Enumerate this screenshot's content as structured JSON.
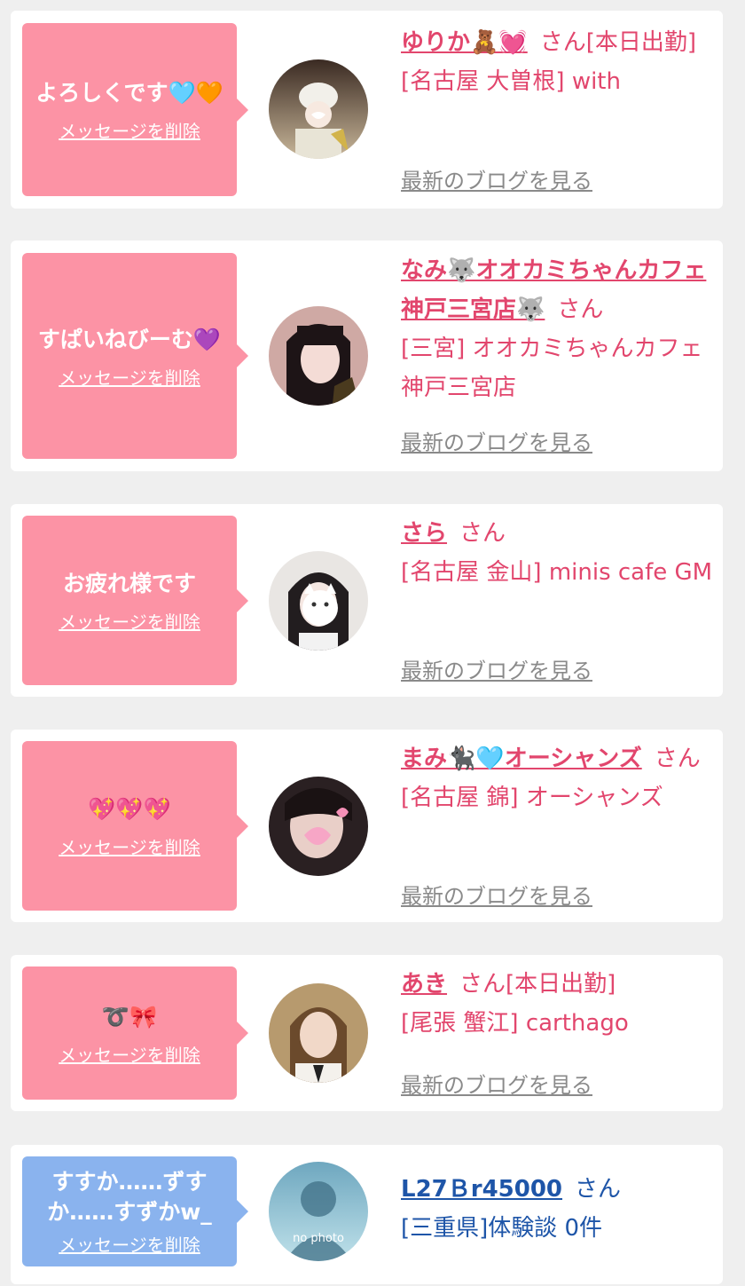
{
  "delete_label": "メッセージを削除",
  "blog_label": "最新のブログを見る",
  "san_label": "さん",
  "colors": {
    "page_bg": "#efefef",
    "card_bg": "#ffffff",
    "bubble_pink": "#fc93a5",
    "bubble_blue": "#8ab3ee",
    "text_pink": "#e2466d",
    "text_blue": "#1e55a8",
    "link_gray": "#8a8a8a"
  },
  "messages": [
    {
      "message": "よろしくです🩵🧡",
      "name": "ゆりか🧸💓",
      "status": "[本日出勤]",
      "shop": "[名古屋 大曽根] with",
      "avatar": "photo"
    },
    {
      "message": "すぱいねびーむ💜",
      "name": "なみ🐺オオカミちゃんカフェ神戸三宮店🐺",
      "status": "",
      "shop": "[三宮] オオカミちゃんカフェ神戸三宮店",
      "avatar": "photo"
    },
    {
      "message": "お疲れ様です",
      "name": "さら",
      "status": "",
      "shop": "[名古屋 金山] minis cafe GM",
      "avatar": "photo"
    },
    {
      "message": "💖💖💖",
      "name": "まみ🐈‍⬛🩵オーシャンズ",
      "status": "",
      "shop": "[名古屋 錦] オーシャンズ",
      "avatar": "photo"
    },
    {
      "message": "➰🎀",
      "name": "あき",
      "status": "[本日出勤]",
      "shop": "[尾張 蟹江] carthago",
      "avatar": "photo"
    },
    {
      "message": "すすか……ずすか……すずかw_",
      "name": "L27Ｂr45000",
      "status": "",
      "shop": "[三重県]体験談 0件",
      "avatar": "no photo"
    }
  ]
}
